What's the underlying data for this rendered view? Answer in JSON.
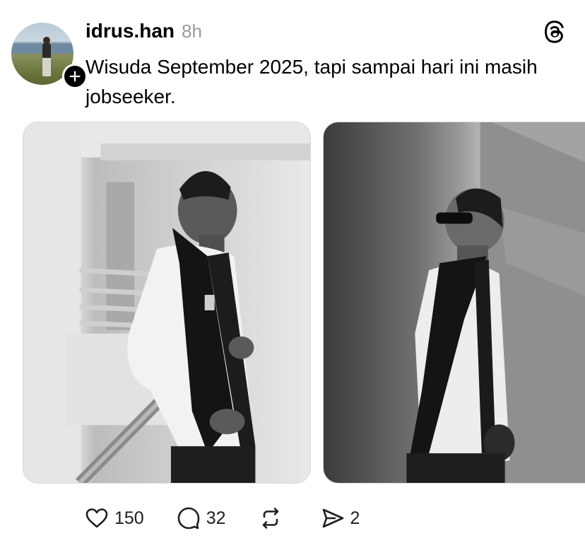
{
  "post": {
    "author": {
      "username": "idrus.han",
      "timestamp": "8h",
      "avatar_icon": "user-avatar",
      "follow_icon": "plus-icon"
    },
    "app_icon": "threads-logo-icon",
    "caption": "Wisuda September 2025, tapi sampai hari ini masih jobseeker.",
    "photos": [
      {
        "description_icon": "photo-1"
      },
      {
        "description_icon": "photo-2"
      }
    ],
    "actions": {
      "like": {
        "icon": "heart-icon",
        "count": "150"
      },
      "reply": {
        "icon": "comment-icon",
        "count": "32"
      },
      "repost": {
        "icon": "repost-icon",
        "count": ""
      },
      "share": {
        "icon": "send-icon",
        "count": "2"
      }
    }
  },
  "colors": {
    "text": "#000000",
    "muted": "#9a9a9a",
    "background": "#ffffff"
  }
}
